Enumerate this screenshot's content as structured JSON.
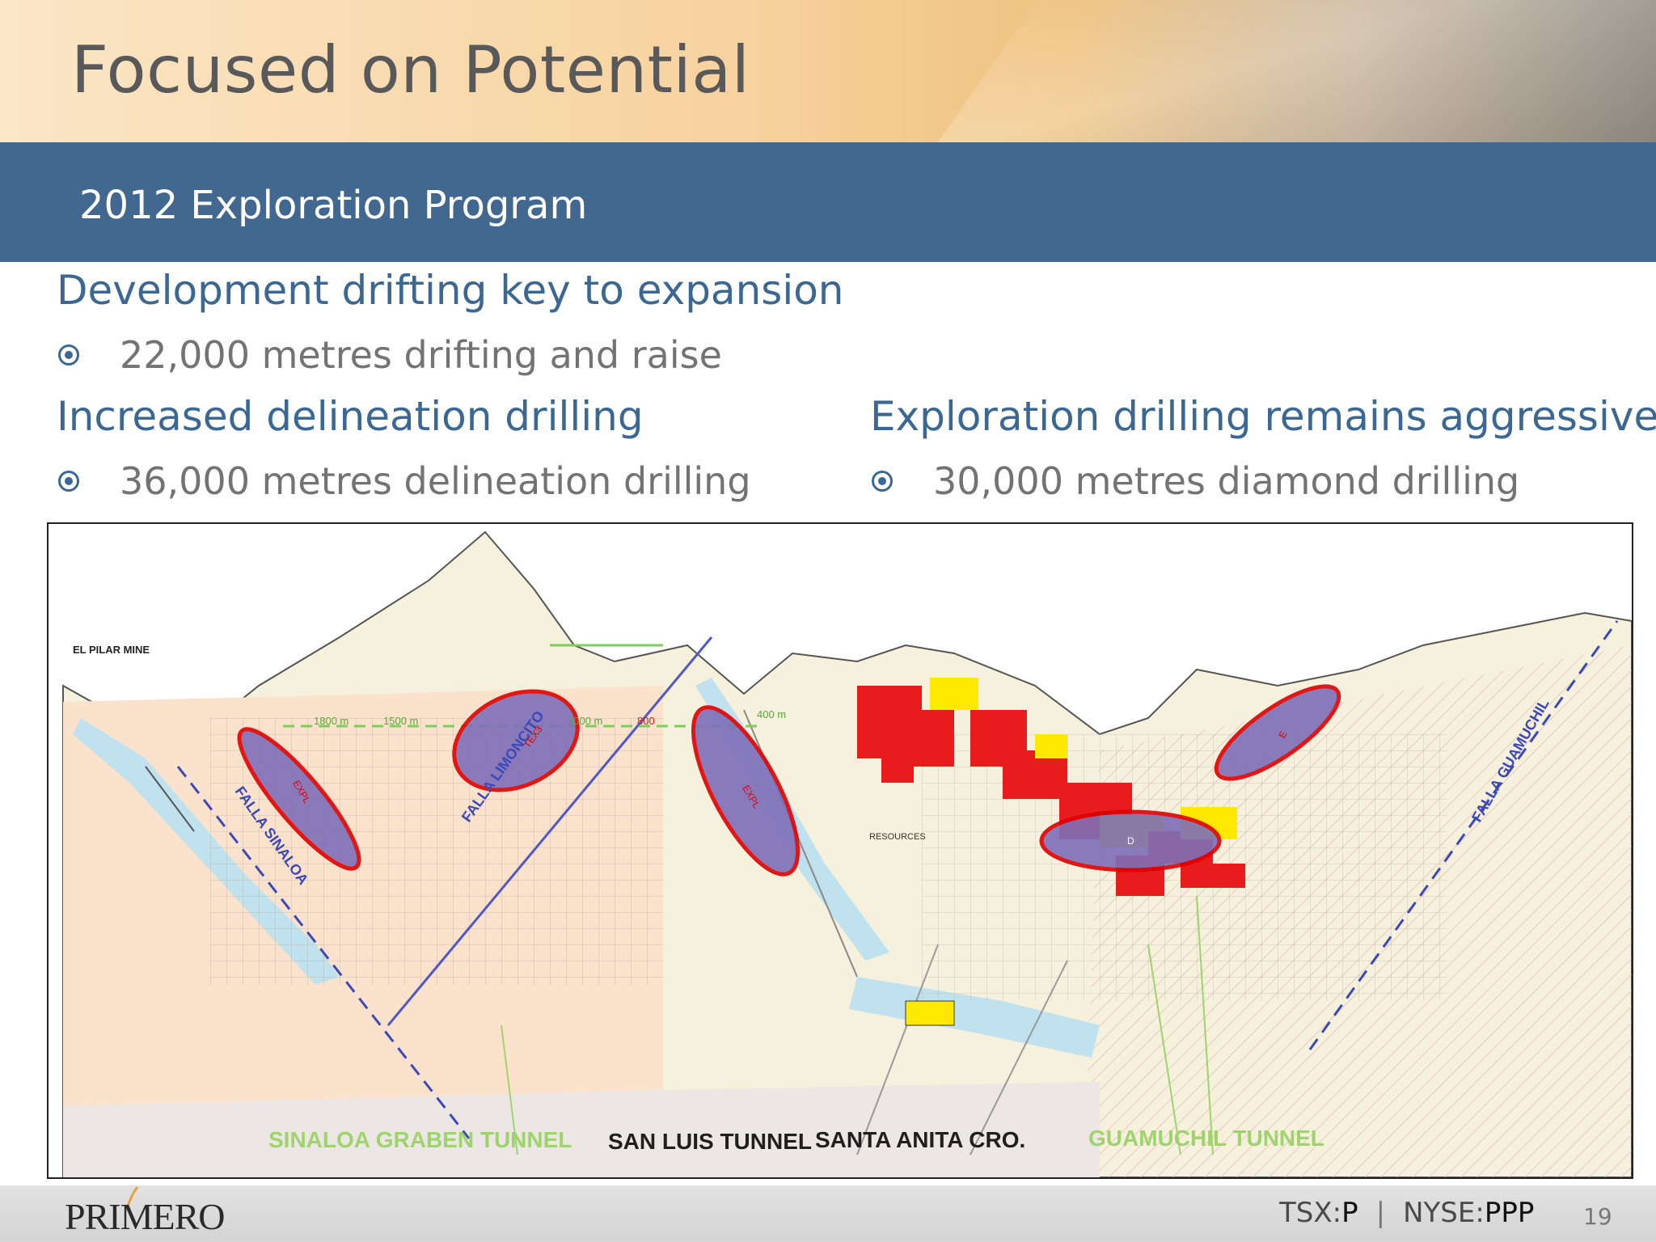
{
  "slide": {
    "title": "Focused on Potential",
    "subtitle": "2012 Exploration Program",
    "sections": [
      {
        "heading": "Development drifting key to expansion",
        "bullet": "22,000 metres drifting and raise"
      },
      {
        "heading": "Increased delineation drilling",
        "bullet": "36,000 metres delineation drilling"
      },
      {
        "heading": "Exploration drilling remains aggressive",
        "bullet": "30,000 metres diamond drilling"
      }
    ]
  },
  "map": {
    "mine_label": "EL PILAR MINE",
    "fault_labels": [
      "FALLA SINALOA",
      "FALLA LIMONCITO",
      "FALLA GUAMUCHIL"
    ],
    "distance_labels": [
      "1800 m",
      "1500 m",
      "1000 m",
      "800",
      "400 m"
    ],
    "target_labels": [
      "EXPL",
      "TEX3",
      "EXPL",
      "E",
      "D"
    ],
    "resources_label": "RESOURCES",
    "tunnels": [
      {
        "name": "SINALOA GRABEN TUNNEL",
        "color": "#9fd36d"
      },
      {
        "name": "SAN LUIS TUNNEL",
        "color": "#1f1f1f"
      },
      {
        "name": "SANTA ANITA CRO.",
        "color": "#1f1f1f"
      },
      {
        "name": "GUAMUCHIL TUNNEL",
        "color": "#9fd36d"
      }
    ]
  },
  "footer": {
    "logo": "PRIMERO",
    "tsx_prefix": "TSX:",
    "tsx_symbol": "P",
    "separator": "|",
    "nyse_prefix": "NYSE:",
    "nyse_symbol": "PPP",
    "page_number": "19"
  },
  "colors": {
    "subtitle_band": "#426890",
    "heading_text": "#3b6793",
    "target_fill": "#7e6fb8",
    "target_stroke": "#e00000",
    "ore_red": "#e81c1c",
    "ore_yellow": "#ffe800"
  }
}
